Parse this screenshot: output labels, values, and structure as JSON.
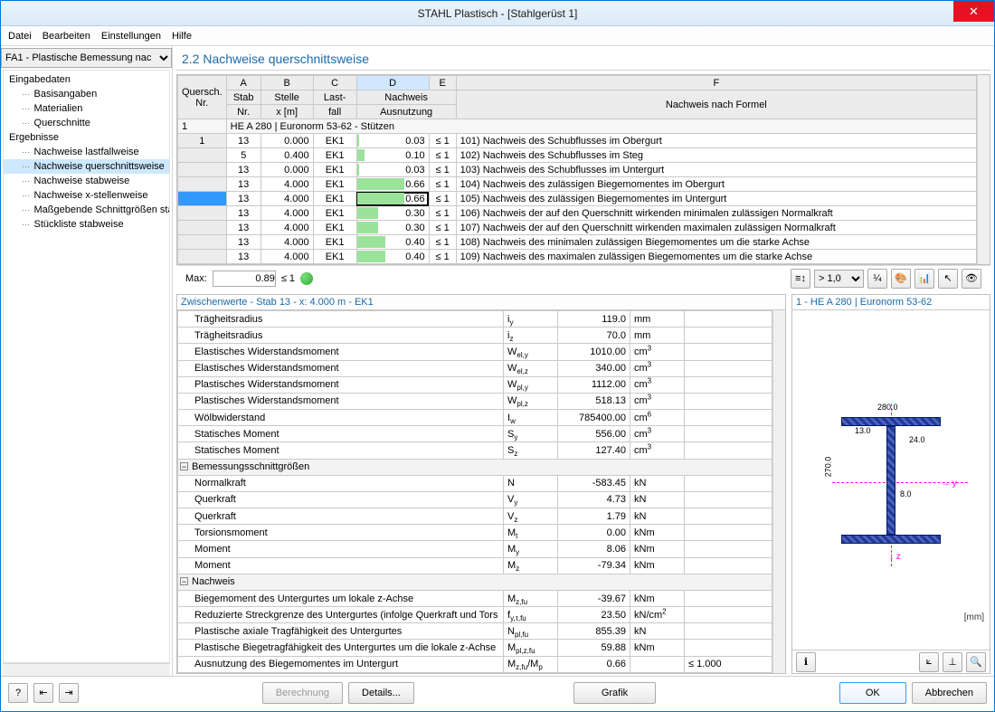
{
  "window": {
    "title": "STAHL Plastisch - [Stahlgerüst 1]"
  },
  "menu": {
    "file": "Datei",
    "edit": "Bearbeiten",
    "settings": "Einstellungen",
    "help": "Hilfe"
  },
  "combo": "FA1 - Plastische Bemessung nac",
  "tree": {
    "g1": "Eingabedaten",
    "g1i": [
      "Basisangaben",
      "Materialien",
      "Querschnitte"
    ],
    "g2": "Ergebnisse",
    "g2i": [
      "Nachweise lastfallweise",
      "Nachweise querschnittsweise",
      "Nachweise stabweise",
      "Nachweise x-stellenweise",
      "Maßgebende Schnittgrößen sta",
      "Stückliste stabweise"
    ],
    "sel": "Nachweise querschnittsweise"
  },
  "section_title": "2.2 Nachweise querschnittsweise",
  "cols": {
    "letters": [
      "A",
      "B",
      "C",
      "D",
      "E",
      "F"
    ],
    "q": "Quersch.",
    "nr": "Nr.",
    "stab": "Stab",
    "stabNr": "Nr.",
    "stelle": "Stelle",
    "x": "x [m]",
    "lf": "Last-",
    "lf2": "fall",
    "nw": "Nachweis",
    "aus": "Ausnutzung",
    "formel": "Nachweis nach Formel"
  },
  "sect_row": "HE A 280 | Euronorm 53-62 - Stützen",
  "rows": [
    {
      "q": "1",
      "stab": "13",
      "x": "0.000",
      "lf": "EK1",
      "aus": "0.03",
      "bar": 3,
      "cmp": "≤ 1",
      "f": "101) Nachweis des Schubflusses im Obergurt"
    },
    {
      "q": "",
      "stab": "5",
      "x": "0.400",
      "lf": "EK1",
      "aus": "0.10",
      "bar": 10,
      "cmp": "≤ 1",
      "f": "102) Nachweis des Schubflusses im Steg"
    },
    {
      "q": "",
      "stab": "13",
      "x": "0.000",
      "lf": "EK1",
      "aus": "0.03",
      "bar": 3,
      "cmp": "≤ 1",
      "f": "103) Nachweis des Schubflusses im Untergurt"
    },
    {
      "q": "",
      "stab": "13",
      "x": "4.000",
      "lf": "EK1",
      "aus": "0.66",
      "bar": 66,
      "cmp": "≤ 1",
      "f": "104) Nachweis des zulässigen Biegemomentes im Obergurt"
    },
    {
      "q": "",
      "stab": "13",
      "x": "4.000",
      "lf": "EK1",
      "aus": "0.66",
      "bar": 66,
      "cmp": "≤ 1",
      "f": "105) Nachweis des zulässigen Biegemomentes im Untergurt",
      "hl": true
    },
    {
      "q": "",
      "stab": "13",
      "x": "4.000",
      "lf": "EK1",
      "aus": "0.30",
      "bar": 30,
      "cmp": "≤ 1",
      "f": "106) Nachweis der auf den Querschnitt wirkenden minimalen zulässigen Normalkraft"
    },
    {
      "q": "",
      "stab": "13",
      "x": "4.000",
      "lf": "EK1",
      "aus": "0.30",
      "bar": 30,
      "cmp": "≤ 1",
      "f": "107) Nachweis der auf den Querschnitt wirkenden maximalen zulässigen Normalkraft"
    },
    {
      "q": "",
      "stab": "13",
      "x": "4.000",
      "lf": "EK1",
      "aus": "0.40",
      "bar": 40,
      "cmp": "≤ 1",
      "f": "108) Nachweis des minimalen zulässigen Biegemomentes um die starke Achse"
    },
    {
      "q": "",
      "stab": "13",
      "x": "4.000",
      "lf": "EK1",
      "aus": "0.40",
      "bar": 40,
      "cmp": "≤ 1",
      "f": "109) Nachweis des maximalen zulässigen Biegemomentes um die starke Achse"
    }
  ],
  "max": {
    "label": "Max:",
    "value": "0.89",
    "cmp": "≤ 1"
  },
  "filter": "> 1,0",
  "detail_title": "Zwischenwerte - Stab 13 - x: 4.000 m - EK1",
  "details": [
    {
      "lab": "Trägheitsradius",
      "sym": "i<sub>y</sub>",
      "val": "119.0",
      "u": "mm"
    },
    {
      "lab": "Trägheitsradius",
      "sym": "i<sub>z</sub>",
      "val": "70.0",
      "u": "mm"
    },
    {
      "lab": "Elastisches Widerstandsmoment",
      "sym": "W<sub>el,y</sub>",
      "val": "1010.00",
      "u": "cm<sup>3</sup>"
    },
    {
      "lab": "Elastisches Widerstandsmoment",
      "sym": "W<sub>el,z</sub>",
      "val": "340.00",
      "u": "cm<sup>3</sup>"
    },
    {
      "lab": "Plastisches Widerstandsmoment",
      "sym": "W<sub>pl,y</sub>",
      "val": "1112.00",
      "u": "cm<sup>3</sup>"
    },
    {
      "lab": "Plastisches Widerstandsmoment",
      "sym": "W<sub>pl,z</sub>",
      "val": "518.13",
      "u": "cm<sup>3</sup>"
    },
    {
      "lab": "Wölbwiderstand",
      "sym": "I<sub>w</sub>",
      "val": "785400.00",
      "u": "cm<sup>6</sup>"
    },
    {
      "lab": "Statisches Moment",
      "sym": "S<sub>y</sub>",
      "val": "556.00",
      "u": "cm<sup>3</sup>"
    },
    {
      "lab": "Statisches Moment",
      "sym": "S<sub>z</sub>",
      "val": "127.40",
      "u": "cm<sup>3</sup>"
    },
    {
      "group": "Bemessungsschnittgrößen"
    },
    {
      "lab": "Normalkraft",
      "sym": "N",
      "val": "-583.45",
      "u": "kN"
    },
    {
      "lab": "Querkraft",
      "sym": "V<sub>y</sub>",
      "val": "4.73",
      "u": "kN"
    },
    {
      "lab": "Querkraft",
      "sym": "V<sub>z</sub>",
      "val": "1.79",
      "u": "kN"
    },
    {
      "lab": "Torsionsmoment",
      "sym": "M<sub>t</sub>",
      "val": "0.00",
      "u": "kNm"
    },
    {
      "lab": "Moment",
      "sym": "M<sub>y</sub>",
      "val": "8.06",
      "u": "kNm"
    },
    {
      "lab": "Moment",
      "sym": "M<sub>z</sub>",
      "val": "-79.34",
      "u": "kNm"
    },
    {
      "group": "Nachweis"
    },
    {
      "lab": "Biegemoment des Untergurtes um lokale z-Achse",
      "sym": "M<sub>z,fu</sub>",
      "val": "-39.67",
      "u": "kNm"
    },
    {
      "lab": "Reduzierte Streckgrenze des Untergurtes (infolge Querkraft und Tors",
      "sym": "f<sub>y,τ,fu</sub>",
      "val": "23.50",
      "u": "kN/cm<sup>2</sup>"
    },
    {
      "lab": "Plastische axiale Tragfähigkeit des Untergurtes",
      "sym": "N<sub>pl,fu</sub>",
      "val": "855.39",
      "u": "kN"
    },
    {
      "lab": "Plastische Biegetragfähigkeit des Untergurtes um die lokale z-Achse",
      "sym": "M<sub>pl,z,fu</sub>",
      "val": "59.88",
      "u": "kNm"
    },
    {
      "lab": "Ausnutzung des Biegemomentes im Untergurt",
      "sym": "M<sub>z,fu</sub>/M<sub>p</sub>",
      "val": "0.66",
      "u": "",
      "extra": "≤ 1.000"
    }
  ],
  "preview": {
    "title": "1 - HE A 280 | Euronorm 53-62",
    "unit": "[mm]",
    "dims": {
      "width": "280.0",
      "height": "270.0",
      "tf": "13.0",
      "tw": "8.0",
      "r": "24.0"
    }
  },
  "footer": {
    "calc": "Berechnung",
    "det": "Details...",
    "gfx": "Grafik",
    "ok": "OK",
    "cancel": "Abbrechen"
  }
}
